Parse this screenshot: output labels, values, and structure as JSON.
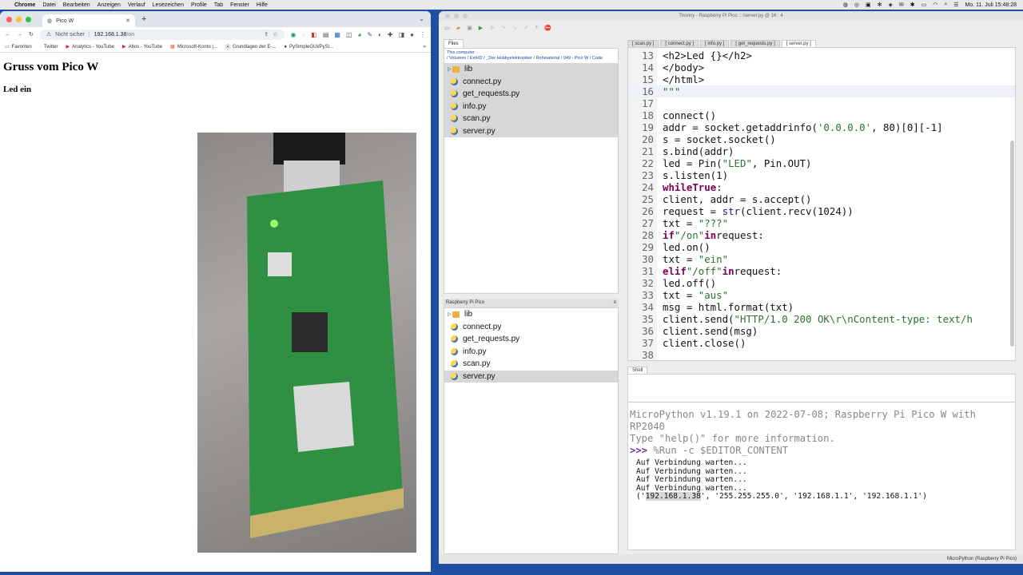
{
  "menubar": {
    "app": "Chrome",
    "items": [
      "Datei",
      "Bearbeiten",
      "Anzeigen",
      "Verlauf",
      "Lesezeichen",
      "Profile",
      "Tab",
      "Fenster",
      "Hilfe"
    ],
    "clock": "Mo. 11. Juli  15:48:28"
  },
  "browser": {
    "tab_title": "Pico W",
    "security": "Nicht sicher",
    "url_host": "192.168.1.38",
    "url_path": "/on",
    "bookmarks": [
      "Favoriten",
      "Twitter",
      "Analytics - YouTube",
      "Abos - YouTube",
      "Microsoft-Konto |...",
      "Grundlagen der E-...",
      "PySimpleGUI/PySi..."
    ],
    "page": {
      "heading": "Gruss vom Pico W",
      "status": "Led ein"
    }
  },
  "thonny": {
    "title": "Thonny  -  Raspberry Pi Pico :: /server.py  @  16 : 4",
    "files_tab": "Files",
    "this_computer": "This computer",
    "computer_path": "/ Volumes / ExtHD / _Der Hobbyelektroniker / Rohmaterial / 049 - Pico W / Code",
    "computer_files": [
      "lib",
      "connect.py",
      "get_requests.py",
      "info.py",
      "scan.py",
      "server.py"
    ],
    "pico_label": "Raspberry Pi Pico",
    "pico_files": [
      "lib",
      "connect.py",
      "get_requests.py",
      "info.py",
      "scan.py",
      "server.py"
    ],
    "editor_tabs": [
      "[ scan.py ]",
      "[ connect.py ]",
      "[ info.py ]",
      "[ get_requests.py ]",
      "[ server.py ]"
    ],
    "shell_tab": "Shell",
    "shell_banner": "MicroPython v1.19.1 on 2022-07-08; Raspberry Pi Pico W with RP2040",
    "shell_help": "Type \"help()\" for more information.",
    "shell_prompt": ">>>",
    "shell_command": "%Run -c $EDITOR_CONTENT",
    "shell_output": [
      "Auf Verbindung warten...",
      "Auf Verbindung warten...",
      "Auf Verbindung warten...",
      "Auf Verbindung warten..."
    ],
    "shell_ip": "192.168.1.38",
    "shell_ip_rest": "', '255.255.255.0', '192.168.1.1', '192.168.1.1')",
    "status": "MicroPython (Raspberry Pi Pico)"
  }
}
